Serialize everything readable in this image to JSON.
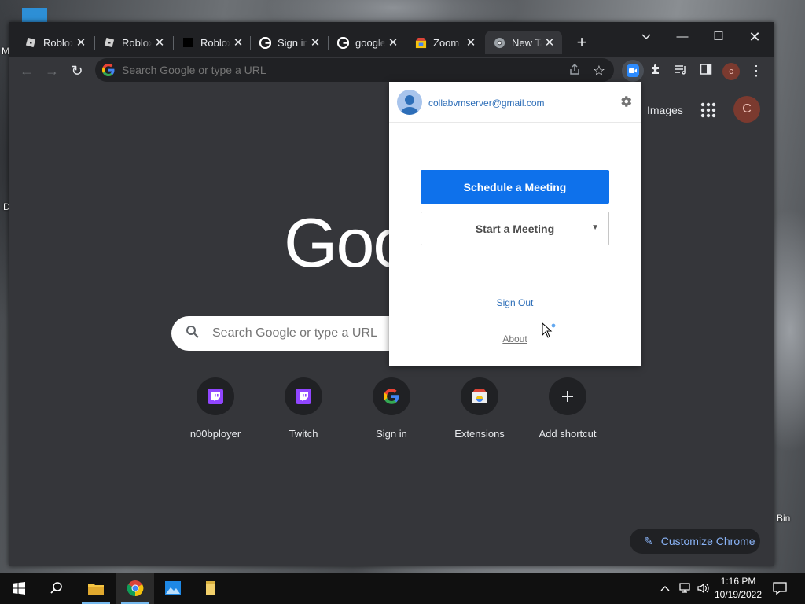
{
  "desktop": {
    "left_labels": [
      "M",
      "D"
    ],
    "right_label": "Bin"
  },
  "browser": {
    "tabs": [
      {
        "title": "Roblox",
        "favicon": "roblox-icon"
      },
      {
        "title": "Roblox",
        "favicon": "roblox-icon"
      },
      {
        "title": "Roblox",
        "favicon": "roblox-black-icon"
      },
      {
        "title": "Sign in",
        "favicon": "google-icon"
      },
      {
        "title": "google",
        "favicon": "google-icon"
      },
      {
        "title": "Zoom",
        "favicon": "zoom-store-icon"
      },
      {
        "title": "New Tab",
        "favicon": "chrome-icon",
        "active": true
      }
    ],
    "omnibox_placeholder": "Search Google or type a URL",
    "profile_initial": "c"
  },
  "newtab": {
    "images_link": "Images",
    "profile_initial": "C",
    "logo_text": "Goo",
    "search_placeholder": "Search Google or type a URL",
    "shortcuts": [
      {
        "label": "n00bployer",
        "icon": "twitch-icon"
      },
      {
        "label": "Twitch",
        "icon": "twitch-icon"
      },
      {
        "label": "Sign in",
        "icon": "google-icon"
      },
      {
        "label": "Extensions",
        "icon": "chrome-webstore-icon"
      },
      {
        "label": "Add shortcut",
        "icon": "plus-icon"
      }
    ],
    "customize_label": "Customize Chrome"
  },
  "zoom_popup": {
    "email": "collabvmserver@gmail.com",
    "schedule_label": "Schedule a Meeting",
    "start_label": "Start a Meeting",
    "sign_out": "Sign Out",
    "about": "About"
  },
  "taskbar": {
    "time": "1:16 PM",
    "date": "10/19/2022"
  },
  "colors": {
    "zoom_blue": "#0e71eb",
    "link_blue": "#2d6eb8",
    "chrome_dark": "#35363a",
    "twitch_purple": "#9146ff"
  }
}
